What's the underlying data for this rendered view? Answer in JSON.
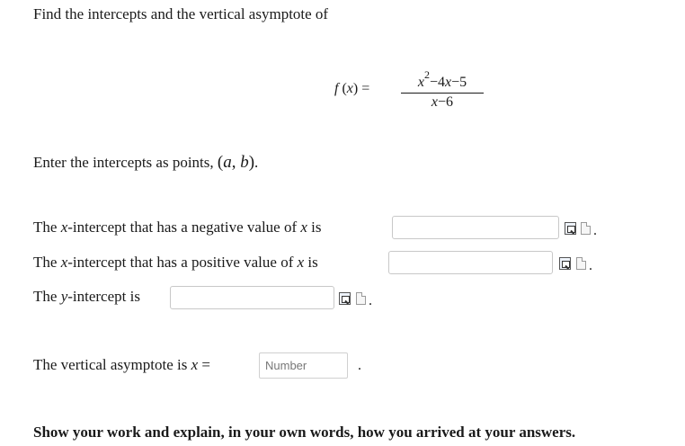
{
  "question": {
    "intro": "Find the intercepts and the vertical asymptote of",
    "function_label": "f(x) =",
    "numerator": "x2−4x−5",
    "denominator": "x−6",
    "instruction_prefix": "Enter the intercepts as points,",
    "instruction_point": "(a, b)",
    "instruction_suffix": "."
  },
  "prompts": {
    "neg_x_intercept": "The x-intercept that has a negative value of x is",
    "pos_x_intercept": "The x-intercept that has a positive value of x is",
    "y_intercept": "The y-intercept is",
    "vertical_asymptote": "The vertical asymptote is x ="
  },
  "inputs": {
    "asymptote_placeholder": "Number"
  },
  "footer": {
    "instruction": "Show your work and explain, in your own words, how you arrived at your answers."
  },
  "icons": [
    "preview-icon",
    "document-icon"
  ]
}
